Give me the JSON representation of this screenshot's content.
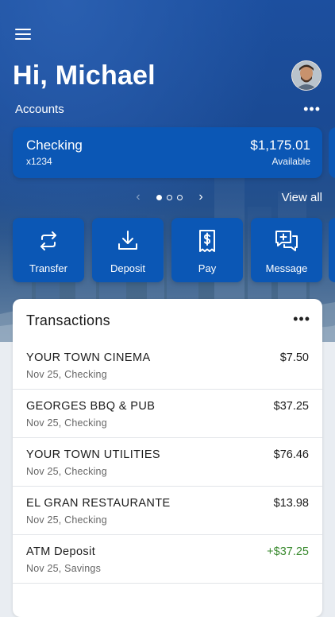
{
  "header": {
    "greeting": "Hi, Michael",
    "menu_icon": "hamburger-menu-icon",
    "avatar_icon": "user-avatar"
  },
  "accounts": {
    "label": "Accounts",
    "more_label": "•••",
    "card": {
      "name": "Checking",
      "number": "x1234",
      "balance": "$1,175.01",
      "balance_label": "Available"
    },
    "pager": {
      "prev": "‹",
      "next": "›",
      "total_pages": 3,
      "current_page": 1
    },
    "view_all_label": "View all"
  },
  "actions": [
    {
      "label": "Transfer",
      "icon": "transfer-arrows-icon"
    },
    {
      "label": "Deposit",
      "icon": "download-tray-icon"
    },
    {
      "label": "Pay",
      "icon": "bill-dollar-icon"
    },
    {
      "label": "Message",
      "icon": "chat-plus-icon"
    }
  ],
  "transactions": {
    "title": "Transactions",
    "more_label": "•••",
    "items": [
      {
        "merchant": "YOUR TOWN CINEMA",
        "detail": "Nov 25, Checking",
        "amount": "$7.50"
      },
      {
        "merchant": "GEORGES BBQ & PUB",
        "detail": "Nov 25, Checking",
        "amount": "$37.25"
      },
      {
        "merchant": "YOUR TOWN UTILITIES",
        "detail": "Nov 25, Checking",
        "amount": "$76.46"
      },
      {
        "merchant": "EL GRAN RESTAURANTE",
        "detail": "Nov 25, Checking",
        "amount": "$13.98"
      },
      {
        "merchant": "ATM Deposit",
        "detail": "Nov 25, Savings",
        "amount": "+$37.25"
      }
    ]
  },
  "colors": {
    "brand_blue": "#0b57b5",
    "positive_green": "#3a8a2f"
  }
}
